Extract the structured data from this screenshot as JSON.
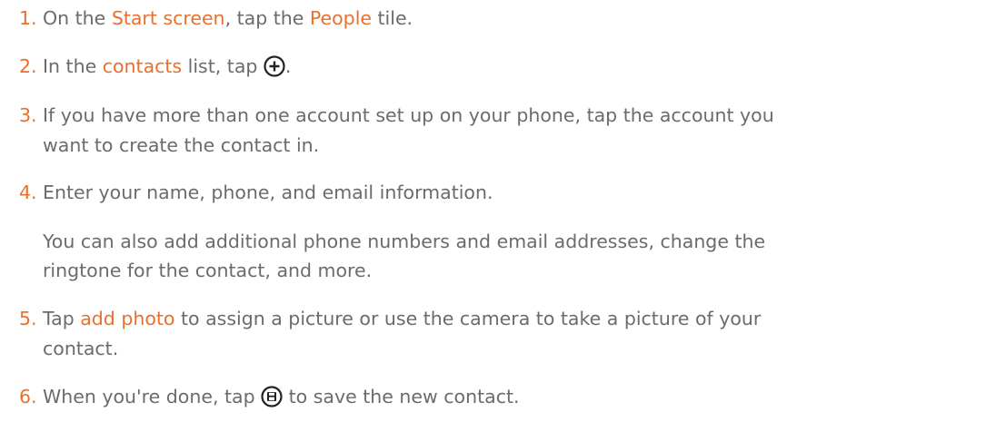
{
  "steps": [
    {
      "number": "1.",
      "parts": [
        "On the ",
        "Start screen",
        ", tap the ",
        "People",
        " tile."
      ]
    },
    {
      "number": "2.",
      "parts": [
        "In the ",
        "contacts",
        " list, tap ",
        "."
      ],
      "icon": "add-circle-icon"
    },
    {
      "number": "3.",
      "line1": "If you have more than one account set up on your phone, tap the account you",
      "line2": "want to create the contact in."
    },
    {
      "number": "4.",
      "line1": "Enter your name, phone, and email information.",
      "note_line1": "You can also add additional phone numbers and email addresses, change the",
      "note_line2": "ringtone for the contact, and more."
    },
    {
      "number": "5.",
      "parts": [
        "Tap ",
        "add photo",
        " to assign a picture or use the camera to take a picture of your"
      ],
      "line2": "contact."
    },
    {
      "number": "6.",
      "parts": [
        "When you're done, tap ",
        " to save the new contact."
      ],
      "icon": "save-circle-icon"
    }
  ],
  "colors": {
    "accent": "#ea6f2d",
    "text": "#6b6b6b"
  }
}
